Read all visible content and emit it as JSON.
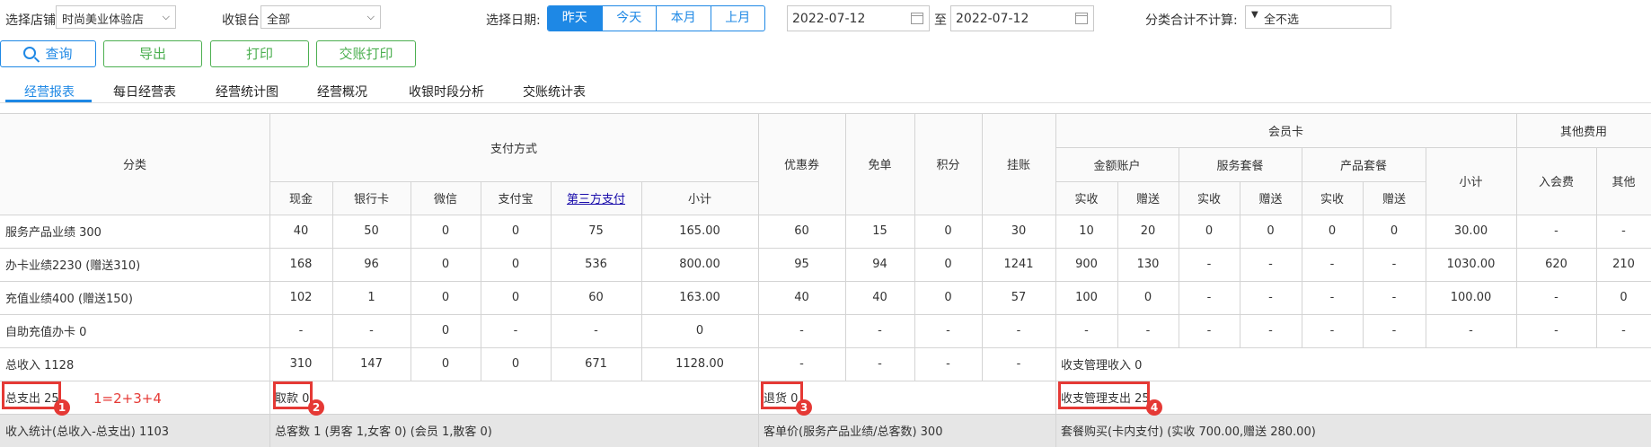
{
  "filters": {
    "store_label": "选择店铺:",
    "store_value": "时尚美业体验店",
    "cashier_label": "收银台:",
    "cashier_value": "全部",
    "date_label": "选择日期:",
    "date_tabs": [
      "昨天",
      "今天",
      "本月",
      "上月"
    ],
    "date_tab_active": "昨天",
    "date_start": "2022-07-12",
    "date_sep": "至",
    "date_end": "2022-07-12",
    "category_label": "分类合计不计算:",
    "category_value": "全不选"
  },
  "buttons": {
    "query": "查询",
    "export": "导出",
    "print": "打印",
    "shift_print": "交账打印"
  },
  "tabs": [
    "经营报表",
    "每日经营表",
    "经营统计图",
    "经营概况",
    "收银时段分析",
    "交账统计表"
  ],
  "tab_active": "经营报表",
  "table": {
    "header_top": {
      "category": "分类",
      "payment": "支付方式",
      "coupon": "优惠券",
      "free": "免单",
      "points": "积分",
      "credit": "挂账",
      "member": "会员卡",
      "other_fees": "其他费用"
    },
    "header_payment": [
      "现金",
      "银行卡",
      "微信",
      "支付宝",
      "第三方支付",
      "小计"
    ],
    "header_member_groups": [
      "金额账户",
      "服务套餐",
      "产品套餐"
    ],
    "header_member_sub": [
      "实收",
      "赠送",
      "实收",
      "赠送",
      "实收",
      "赠送"
    ],
    "header_member_subtotal": "小计",
    "header_other": [
      "入会费",
      "其他"
    ],
    "rows": [
      {
        "label": "服务产品业绩 300",
        "cells": [
          "40",
          "50",
          "0",
          "0",
          "75",
          "165.00",
          "60",
          "15",
          "0",
          "30",
          "10",
          "20",
          "0",
          "0",
          "0",
          "0",
          "30.00",
          "-",
          "-"
        ]
      },
      {
        "label": "办卡业绩2230 (赠送310)",
        "cells": [
          "168",
          "96",
          "0",
          "0",
          "536",
          "800.00",
          "95",
          "94",
          "0",
          "1241",
          "900",
          "130",
          "-",
          "-",
          "-",
          "-",
          "1030.00",
          "620",
          "210"
        ]
      },
      {
        "label": "充值业绩400 (赠送150)",
        "cells": [
          "102",
          "1",
          "0",
          "0",
          "60",
          "163.00",
          "40",
          "40",
          "0",
          "57",
          "100",
          "0",
          "-",
          "-",
          "-",
          "-",
          "100.00",
          "-",
          "0"
        ]
      },
      {
        "label": "自助充值办卡 0",
        "cells": [
          "-",
          "-",
          "0",
          "-",
          "-",
          "0",
          "-",
          "-",
          "-",
          "-",
          "-",
          "-",
          "-",
          "-",
          "-",
          "-",
          "-",
          "-",
          "-"
        ]
      },
      {
        "label": "总收入 1128",
        "cells": [
          "310",
          "147",
          "0",
          "0",
          "671",
          "1128.00",
          "-",
          "-",
          "-",
          "-"
        ],
        "extra": "收支管理收入 0"
      }
    ],
    "expense_row": {
      "total_expense": "总支出 25",
      "formula": "1=2+3+4",
      "withdraw": "取款 0",
      "refund": "退货 0",
      "mgmt_expense": "收支管理支出 25"
    },
    "summary_row": {
      "income_stat": "收入统计(总收入-总支出) 1103",
      "customers": "总客数 1 (男客 1,女客 0) (会员 1,散客 0)",
      "avg_price": "客单价(服务产品业绩/总客数) 300",
      "package_buy": "套餐购买(卡内支付) (实收 700.00,赠送 280.00)"
    },
    "badges": [
      "1",
      "2",
      "3",
      "4"
    ]
  },
  "colors": {
    "accent": "#1e88e5",
    "green": "#4caf50",
    "annotation": "#e53935"
  }
}
